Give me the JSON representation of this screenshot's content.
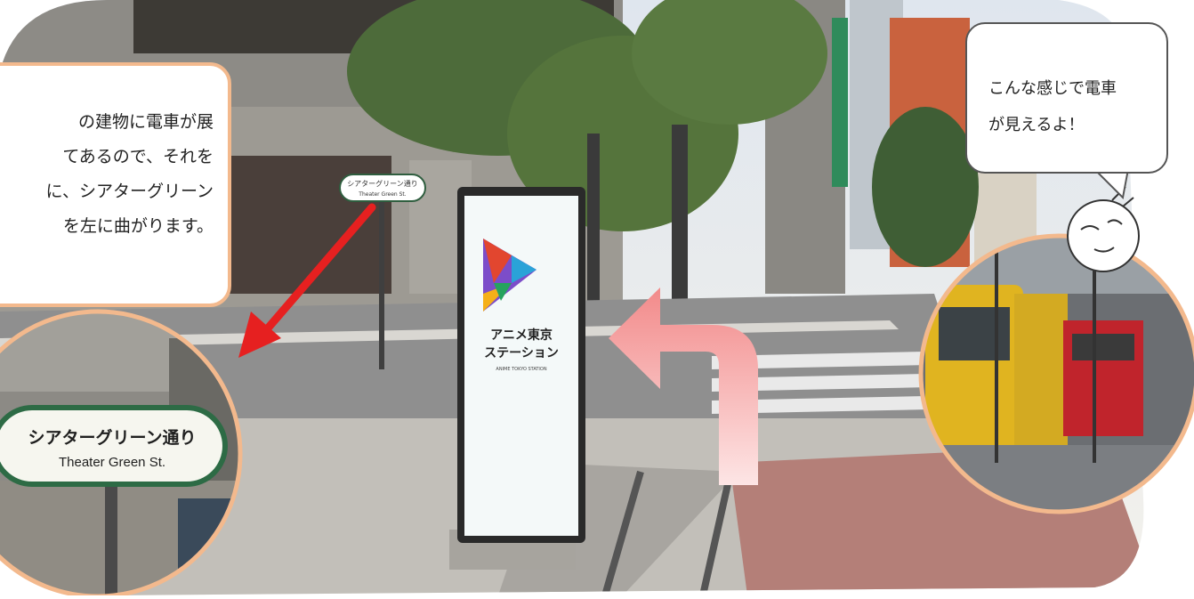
{
  "left_bubble": {
    "lines": [
      "の建物に電車が展",
      "てあるので、それを",
      "に、シアターグリーン",
      "を左に曲がります。"
    ]
  },
  "right_bubble": {
    "lines": [
      "こんな感じで電車",
      "が見えるよ！"
    ]
  },
  "sign_inset": {
    "jp": "シアターグリーン通り",
    "en": "Theater Green St."
  },
  "monument": {
    "line1": "アニメ東京",
    "line2": "ステーション",
    "small": "ANIME TOKYO STATION"
  },
  "street_sign": {
    "jp": "シアターグリーン通り",
    "en": "Theater Green St."
  },
  "colors": {
    "accent_border": "#f3b98d",
    "red_arrow": "#e62020",
    "pink_arrow": "#f59a9a"
  }
}
